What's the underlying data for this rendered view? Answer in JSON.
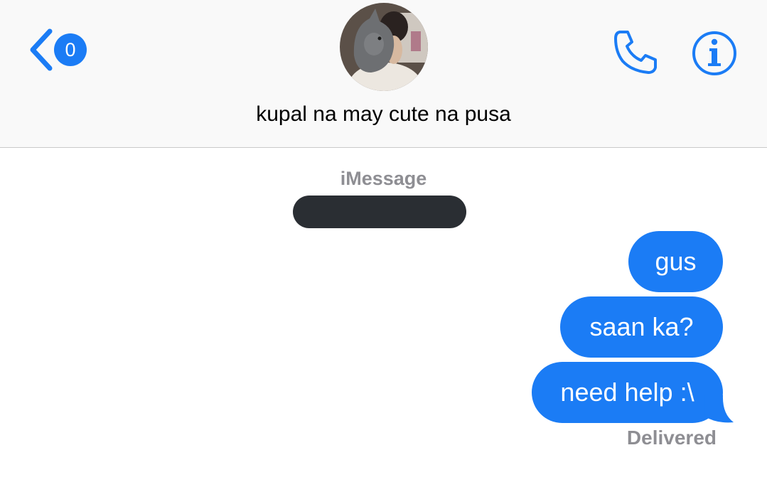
{
  "header": {
    "back_badge_count": "0",
    "contact_name": "kupal na may cute na pusa"
  },
  "conversation": {
    "service_label": "iMessage",
    "messages": [
      {
        "text": "gus",
        "direction": "outgoing"
      },
      {
        "text": "saan ka?",
        "direction": "outgoing"
      },
      {
        "text": "need help :\\",
        "direction": "outgoing"
      }
    ],
    "delivery_status": "Delivered"
  },
  "icons": {
    "back": "chevron-left-icon",
    "call": "phone-icon",
    "details": "info-icon"
  },
  "colors": {
    "accent": "#1b7cf5",
    "bubble_text": "#ffffff",
    "secondary_text": "#8e8e93",
    "redaction": "#2a2e33"
  }
}
